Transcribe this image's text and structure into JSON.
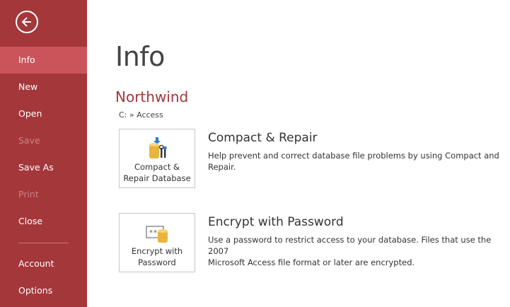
{
  "sidebar": {
    "back_icon": "back-arrow-icon",
    "items": [
      {
        "label": "Info",
        "state": "active"
      },
      {
        "label": "New",
        "state": "normal"
      },
      {
        "label": "Open",
        "state": "normal"
      },
      {
        "label": "Save",
        "state": "disabled"
      },
      {
        "label": "Save As",
        "state": "normal"
      },
      {
        "label": "Print",
        "state": "disabled"
      },
      {
        "label": "Close",
        "state": "normal"
      },
      {
        "label": "Account",
        "state": "normal"
      },
      {
        "label": "Options",
        "state": "normal"
      }
    ],
    "accent_color": "#a4373a",
    "active_color": "#c9555a"
  },
  "main": {
    "title": "Info",
    "db_name": "Northwind",
    "db_path": "C: » Access",
    "sections": [
      {
        "button_line1": "Compact &",
        "button_line2": "Repair Database",
        "icon": "compact-repair-icon",
        "title": "Compact & Repair",
        "description": "Help prevent and correct database file problems by using Compact and Repair."
      },
      {
        "button_line1": "Encrypt with",
        "button_line2": "Password",
        "icon": "encrypt-password-icon",
        "title": "Encrypt with Password",
        "description_line1": "Use a password to restrict access to your database. Files that use the 2007",
        "description_line2": "Microsoft Access file format or later are encrypted."
      }
    ]
  }
}
